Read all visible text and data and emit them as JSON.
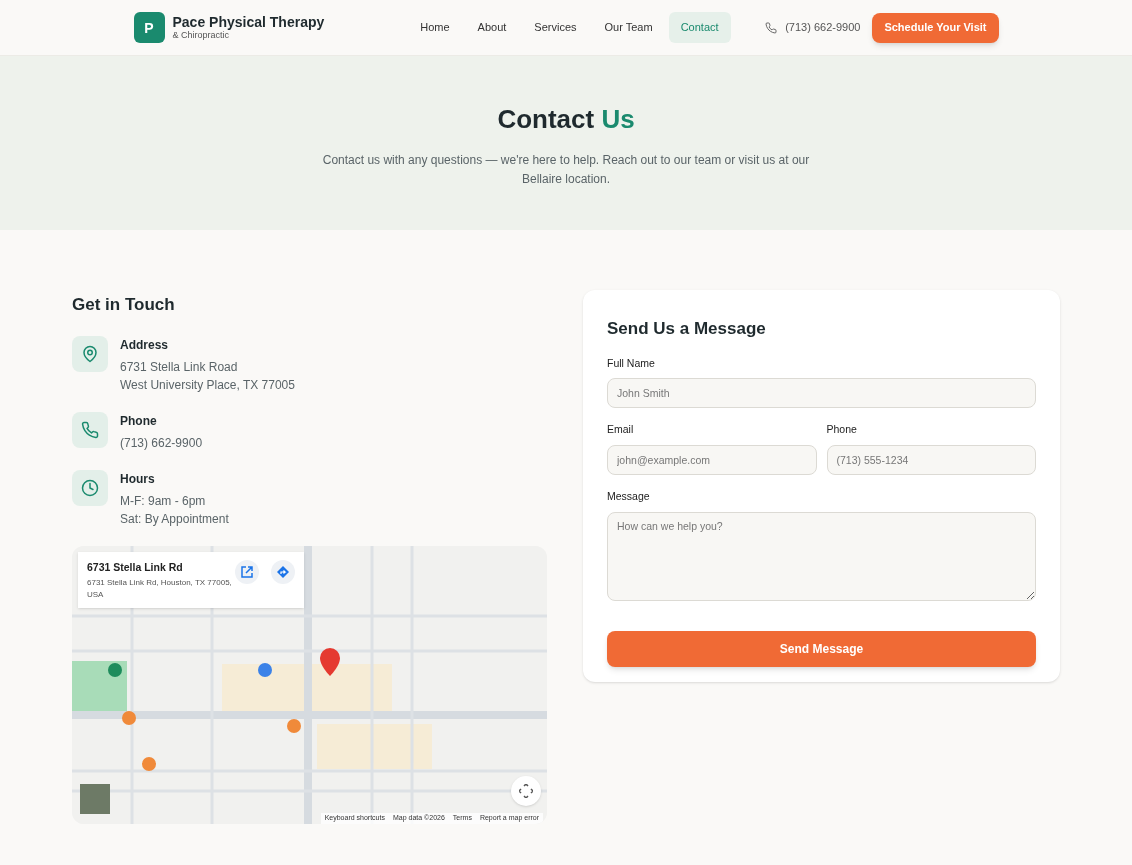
{
  "header": {
    "logo_letter": "P",
    "brand": "Pace Physical Therapy",
    "tagline": "& Chiropractic",
    "nav": [
      {
        "label": "Home",
        "selected": false
      },
      {
        "label": "About",
        "selected": false
      },
      {
        "label": "Services",
        "selected": false
      },
      {
        "label": "Our Team",
        "selected": false
      },
      {
        "label": "Contact",
        "selected": true
      }
    ],
    "phone": "(713) 662-9900",
    "cta": "Schedule Your Visit"
  },
  "hero": {
    "title": "Contact **Us**",
    "subtitle": "Contact us with any questions — we're here to help. Reach out to our team or visit us at our Bellaire location."
  },
  "contact": {
    "heading": "Get in Touch",
    "items": [
      {
        "kind": "address",
        "label": "Address",
        "lines": [
          "6731 Stella Link Road",
          "West University Place, TX 77005"
        ]
      },
      {
        "kind": "phone",
        "label": "Phone",
        "lines": [
          "(713) 662-9900"
        ]
      },
      {
        "kind": "hours",
        "label": "Hours",
        "lines": [
          "M-F: 9am - 6pm",
          "Sat: By Appointment"
        ]
      }
    ]
  },
  "map": {
    "card_title": "6731 Stella Link Rd",
    "card_address": "6731 Stella Link Rd, Houston, TX 77005, USA",
    "footer_links": [
      "Keyboard shortcuts",
      "Map data ©2026",
      "Terms",
      "Report a map error"
    ]
  },
  "form": {
    "heading": "Send Us a Message",
    "fields": [
      {
        "kind": "text",
        "label": "Full Name",
        "placeholder": "John Smith"
      },
      {
        "kind": "text",
        "label": "Email",
        "placeholder": "john@example.com"
      },
      {
        "kind": "text",
        "label": "Phone",
        "placeholder": "(713) 555-1234"
      },
      {
        "kind": "textarea",
        "label": "Message",
        "placeholder": "How can we help you?"
      }
    ],
    "submit": "Send Message"
  }
}
